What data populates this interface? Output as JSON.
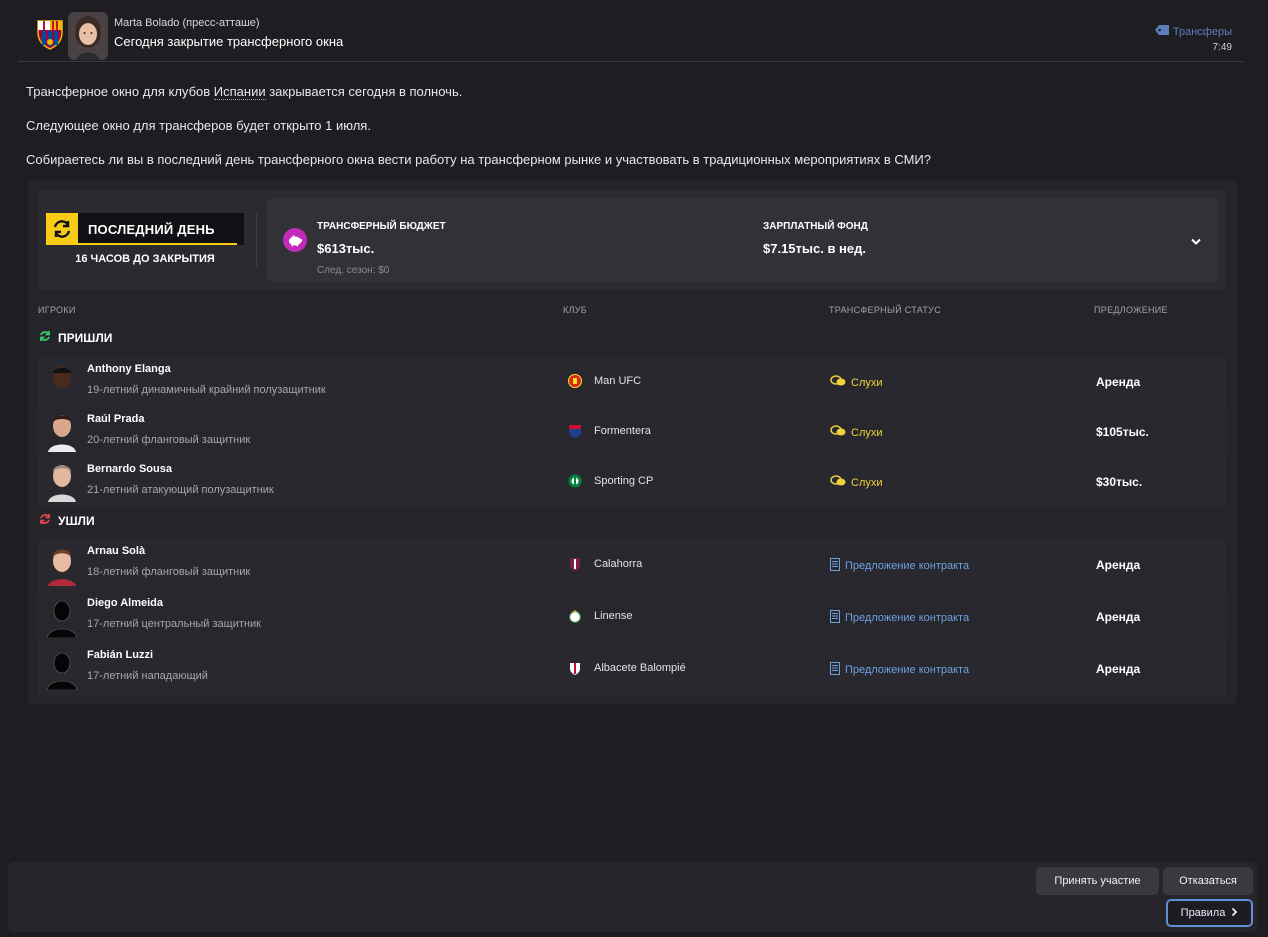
{
  "message": {
    "sender": "Marta Bolado  (пресс-атташе)",
    "subject": "Сегодня закрытие трансферного окна",
    "category": "Трансферы",
    "time": "7:49"
  },
  "body": {
    "paragraph1_prefix": "Трансферное окно для клубов ",
    "paragraph1_link": "Испании",
    "paragraph1_suffix": " закрывается сегодня в полночь.",
    "paragraph2": "Следующее окно для трансферов будет открыто 1 июля.",
    "paragraph3": "Собираетесь ли вы в последний день трансферного окна вести работу на трансферном рынке и участвовать в традиционных мероприятиях в СМИ?"
  },
  "deadline": {
    "title": "ПОСЛЕДНИЙ ДЕНЬ",
    "subtitle": "16 ЧАСОВ ДО ЗАКРЫТИЯ"
  },
  "budget": {
    "transfer_label": "ТРАНСФЕРНЫЙ БЮДЖЕТ",
    "transfer_value": "$613тыс.",
    "transfer_next": "След. сезон: $0",
    "wage_label": "ЗАРПЛАТНЫЙ ФОНД",
    "wage_value": "$7.15тыс. в нед."
  },
  "columns": {
    "players": "ИГРОКИ",
    "club": "КЛУБ",
    "status": "ТРАНСФЕРНЫЙ СТАТУС",
    "offer": "ПРЕДЛОЖЕНИЕ"
  },
  "incoming": {
    "label": "ПРИШЛИ",
    "players": [
      {
        "name": "Anthony Elanga",
        "desc": "19-летний динамичный крайний полузащитник",
        "club": "Man UFC",
        "status": "Слухи",
        "offer": "Аренда"
      },
      {
        "name": "Raúl Prada",
        "desc": "20-летний фланговый защитник",
        "club": "Formentera",
        "status": "Слухи",
        "offer": "$105тыс."
      },
      {
        "name": "Bernardo Sousa",
        "desc": "21-летний атакующий полузащитник",
        "club": "Sporting CP",
        "status": "Слухи",
        "offer": "$30тыс."
      }
    ]
  },
  "outgoing": {
    "label": "УШЛИ",
    "players": [
      {
        "name": "Arnau Solà",
        "desc": "18-летний фланговый защитник",
        "club": "Calahorra",
        "status": "Предложение контракта",
        "offer": "Аренда"
      },
      {
        "name": "Diego Almeida",
        "desc": "17-летний центральный защитник",
        "club": "Linense",
        "status": "Предложение контракта",
        "offer": "Аренда"
      },
      {
        "name": "Fabián Luzzi",
        "desc": "17-летний нападающий",
        "club": "Albacete Balompié",
        "status": "Предложение контракта",
        "offer": "Аренда"
      }
    ]
  },
  "buttons": {
    "accept": "Принять участие",
    "decline": "Отказаться",
    "rules": "Правила"
  },
  "colors": {
    "accent_yellow": "#f6cc16",
    "rumour_yellow": "#f0d23a",
    "contract_blue": "#6fa0e0",
    "piggy_pink": "#c22bb8"
  }
}
